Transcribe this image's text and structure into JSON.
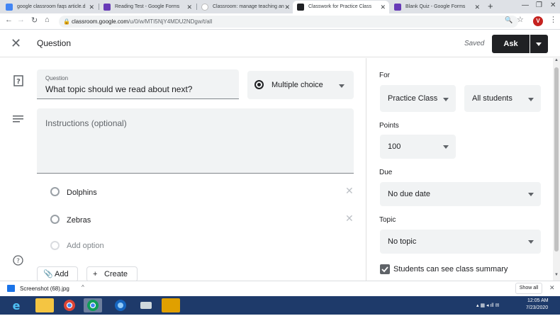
{
  "browser": {
    "tabs": [
      {
        "title": "google classroom faqs article.d",
        "favicon_color": "#4285f4"
      },
      {
        "title": "Reading Test - Google Forms",
        "favicon_color": "#673ab7"
      },
      {
        "title": "Classroom: manage teaching an",
        "favicon_color": "#ffffff"
      },
      {
        "title": "Classwork for Practice Class",
        "favicon_color": "#202124"
      },
      {
        "title": "Blank Quiz - Google Forms",
        "favicon_color": "#673ab7"
      }
    ],
    "url_host": "classroom.google.com",
    "url_path": "/u/0/w/MTI5NjY4MDU2NDgw/t/all",
    "avatar_letter": "V"
  },
  "header": {
    "title": "Question",
    "saved_text": "Saved",
    "ask_label": "Ask"
  },
  "question": {
    "label": "Question",
    "value": "What topic should we read about next?",
    "type_label": "Multiple choice",
    "instructions_placeholder": "Instructions (optional)",
    "options": [
      "Dolphins",
      "Zebras"
    ],
    "add_option": "Add option",
    "add_label": "Add",
    "create_label": "Create"
  },
  "panel": {
    "for_label": "For",
    "class_value": "Practice Class",
    "students_value": "All students",
    "points_label": "Points",
    "points_value": "100",
    "due_label": "Due",
    "due_value": "No due date",
    "topic_label": "Topic",
    "topic_value": "No topic",
    "summary_label": "Students can see class summary"
  },
  "downloads": {
    "file": "Screenshot (68).jpg",
    "show_all": "Show all"
  },
  "taskbar": {
    "time": "12:05 AM",
    "date": "7/23/2020"
  },
  "colors": {
    "accent_dark": "#202124",
    "field_bg": "#f1f3f4",
    "checkbox": "#5f6368"
  }
}
